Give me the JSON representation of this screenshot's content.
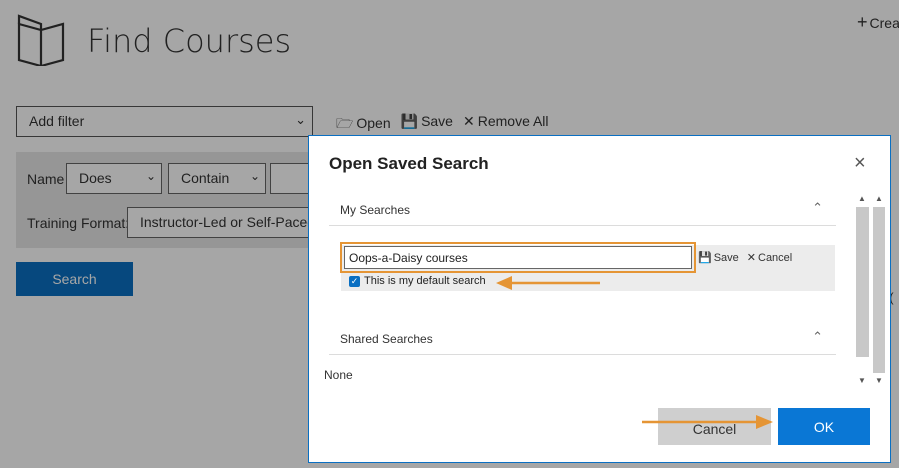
{
  "page": {
    "title": "Find Courses",
    "create_label": "Crea",
    "add_filter_label": "Add filter",
    "toolbar": {
      "open_label": "Open",
      "save_label": "Save",
      "remove_all_label": "Remove All"
    },
    "filters": {
      "name_label": "Name",
      "name_operator_1": "Does",
      "name_operator_2": "Contain",
      "training_format_label": "Training Format:",
      "training_format_value": "Instructor-Led or Self-Paced"
    },
    "search_button": "Search",
    "side_text": "t ("
  },
  "modal": {
    "title": "Open Saved Search",
    "close_glyph": "×",
    "my_searches": {
      "heading": "My Searches",
      "item": {
        "name_value": "Oops-a-Daisy courses",
        "save_label": "Save",
        "cancel_label": "Cancel",
        "default_checkbox_label": "This is my default search",
        "default_checked": true
      }
    },
    "shared_searches": {
      "heading": "Shared Searches",
      "empty_text": "None"
    },
    "buttons": {
      "cancel": "Cancel",
      "ok": "OK"
    }
  },
  "colors": {
    "accent": "#0a6fc2",
    "highlight": "#e59535",
    "overlay": "rgba(0,0,0,0.35)"
  },
  "icons": [
    "book-icon",
    "plus-icon",
    "folder-open-icon",
    "save-icon",
    "close-icon",
    "chevron-down-icon",
    "chevron-up-icon",
    "check-icon"
  ]
}
